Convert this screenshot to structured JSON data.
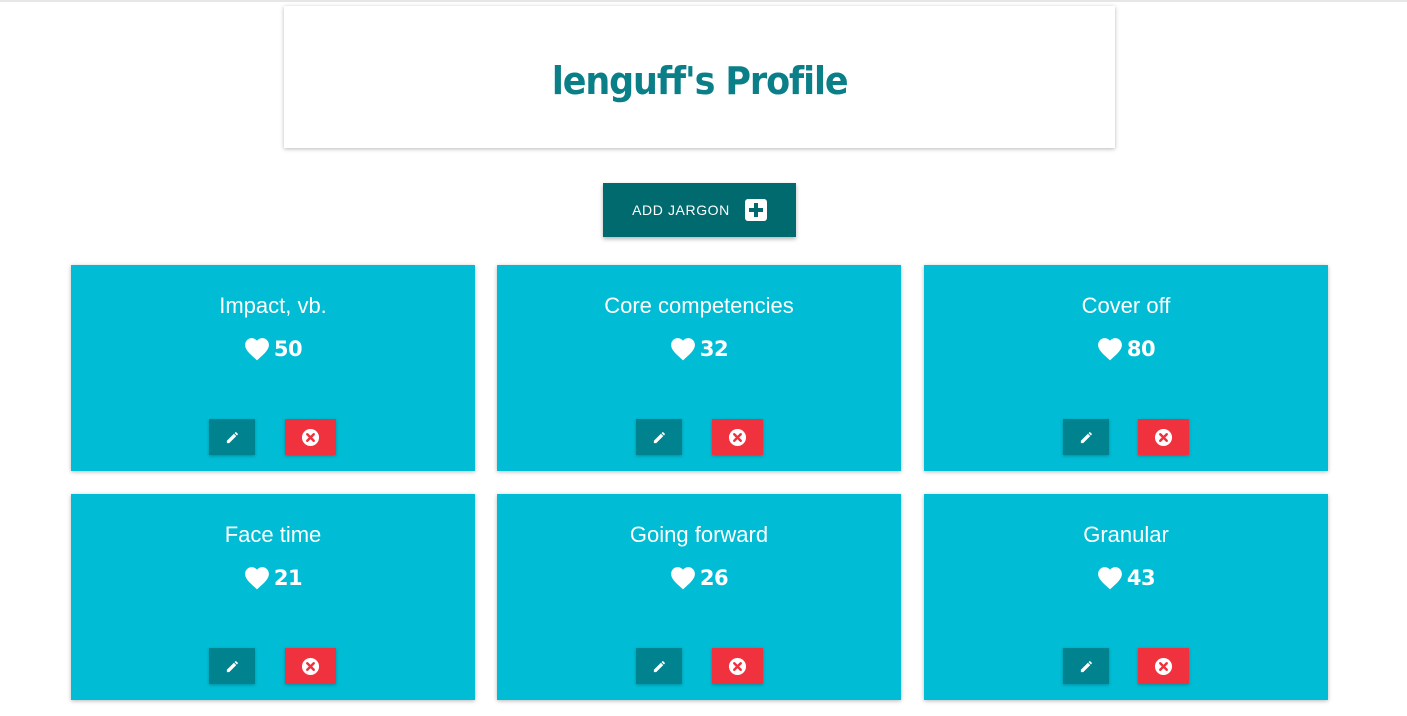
{
  "header": {
    "title": "lenguff's Profile"
  },
  "add_button": {
    "label": "ADD JARGON",
    "icon": "plus-square-icon"
  },
  "colors": {
    "title": "#0b7f88",
    "add_button": "#006a6e",
    "card": "#00bcd4",
    "edit_button": "#00838f",
    "delete_button": "#f0323f"
  },
  "cards": [
    {
      "title": "Impact, vb.",
      "likes": "50"
    },
    {
      "title": "Core competencies",
      "likes": "32"
    },
    {
      "title": "Cover off",
      "likes": "80"
    },
    {
      "title": "Face time",
      "likes": "21"
    },
    {
      "title": "Going forward",
      "likes": "26"
    },
    {
      "title": "Granular",
      "likes": "43"
    }
  ],
  "card_actions": {
    "edit_icon": "pencil-icon",
    "delete_icon": "close-circle-icon"
  }
}
